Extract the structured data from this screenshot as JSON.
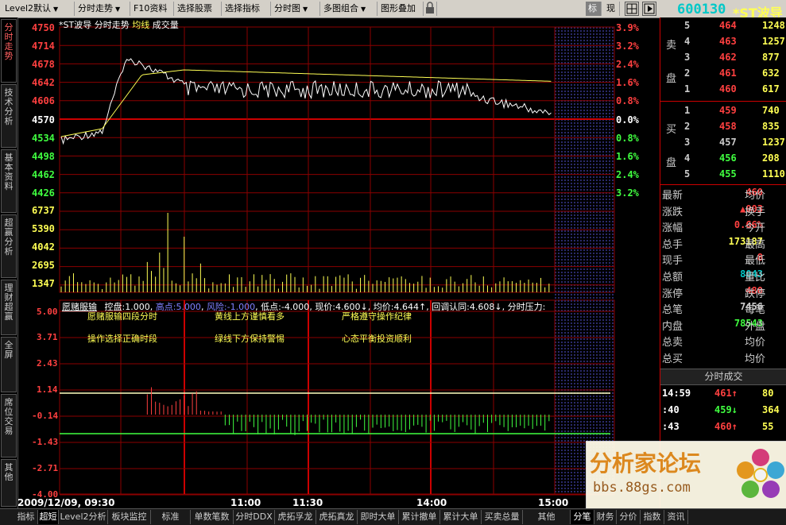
{
  "toolbar": {
    "items": [
      "Level2默认",
      "分时走势",
      "F10资料",
      "选择股票",
      "选择指标",
      "分时图",
      "多图组合",
      "图形叠加"
    ],
    "right_buttons": [
      "标",
      "现"
    ]
  },
  "stock": {
    "code": "600130",
    "name": "*ST波导"
  },
  "left_tabs": [
    {
      "label": "分时走势",
      "active": true
    },
    {
      "label": "技术分析"
    },
    {
      "label": "基本资料"
    },
    {
      "label": "超赢分析"
    },
    {
      "label": "理财超赢"
    },
    {
      "label": "全屏"
    },
    {
      "label": "席位交易"
    },
    {
      "label": "其他"
    }
  ],
  "main": {
    "header": {
      "name": "*ST波导",
      "items": [
        "分时走势",
        "均线",
        "成交量"
      ]
    },
    "price_axis": [
      "4750",
      "4714",
      "4678",
      "4642",
      "4606",
      "4570",
      "4534",
      "4498",
      "4462",
      "4426"
    ],
    "pct_axis": [
      "3.9%",
      "3.2%",
      "2.4%",
      "1.6%",
      "0.8%",
      "0.0%",
      "0.8%",
      "1.6%",
      "2.4%",
      "3.2%"
    ],
    "volume_axis": [
      "6737",
      "5390",
      "4042",
      "2695",
      "1347"
    ],
    "indicator": {
      "name": "愿赌服输",
      "params": [
        {
          "label": "控盘:",
          "value": "1.000"
        },
        {
          "label": "高点:",
          "value": "5.000"
        },
        {
          "label": "风险:",
          "value": "-1.000"
        },
        {
          "label": "低点:",
          "value": "-4.000"
        },
        {
          "label": "现价:",
          "value": "4.600↓"
        },
        {
          "label": "均价:",
          "value": "4.644↑"
        },
        {
          "label": "回调认同:",
          "value": "4.608↓"
        },
        {
          "label": "分时压力:",
          "value": ""
        }
      ],
      "axis": [
        "5.00",
        "3.71",
        "2.43",
        "1.14",
        "-0.14",
        "-1.43",
        "-2.71",
        "-4.00"
      ],
      "annotations": [
        [
          "愿赌服输四段分时",
          "黄线上方谨慎看多",
          "严格遵守操作纪律"
        ],
        [
          "操作选择正确时段",
          "绿线下方保持警惕",
          "心态平衡投资顺利"
        ]
      ]
    },
    "time_axis": {
      "date": "2009/12/09, 09:30",
      "ticks": [
        "11:00",
        "11:30",
        "14:00",
        "15:00"
      ]
    }
  },
  "right_panel": {
    "sell_label": [
      "卖",
      "盘"
    ],
    "buy_label": [
      "买",
      "盘"
    ],
    "sells": [
      {
        "level": "5",
        "price": "464",
        "vol": "1248"
      },
      {
        "level": "4",
        "price": "463",
        "vol": "1257"
      },
      {
        "level": "3",
        "price": "462",
        "vol": "877"
      },
      {
        "level": "2",
        "price": "461",
        "vol": "632"
      },
      {
        "level": "1",
        "price": "460",
        "vol": "617"
      }
    ],
    "buys": [
      {
        "level": "1",
        "price": "459",
        "vol": "740"
      },
      {
        "level": "2",
        "price": "458",
        "vol": "835"
      },
      {
        "level": "3",
        "price": "457",
        "vol": "1237"
      },
      {
        "level": "4",
        "price": "456",
        "vol": "208"
      },
      {
        "level": "5",
        "price": "455",
        "vol": "1110"
      }
    ],
    "stats": [
      {
        "l": "最新",
        "v": "460",
        "c": "#ff4040",
        "r": "均价"
      },
      {
        "l": "涨跌",
        "v": "▲003",
        "c": "#ff4040",
        "r": "换手"
      },
      {
        "l": "涨幅",
        "v": "0.66%",
        "c": "#ff4040",
        "r": "今开"
      },
      {
        "l": "总手",
        "v": "173187",
        "c": "#ffff54",
        "r": "最高"
      },
      {
        "l": "现手",
        "v": "8",
        "c": "#ff4040",
        "r": "最低"
      },
      {
        "l": "总额",
        "v": "8043",
        "c": "#00c8c8",
        "r": "量比"
      },
      {
        "l": "涨停",
        "v": "480",
        "c": "#ff4040",
        "r": "跌停"
      },
      {
        "l": "总笔",
        "v": "7456",
        "c": "#ccc",
        "r": "每笔"
      },
      {
        "l": "内盘",
        "v": "78543",
        "c": "#40ff40",
        "r": "外盘"
      },
      {
        "l": "总卖",
        "v": "",
        "c": "#ccc",
        "r": "均价"
      },
      {
        "l": "总买",
        "v": "",
        "c": "#ccc",
        "r": "均价"
      }
    ],
    "trades_header": "分时成交",
    "trades": [
      {
        "t": "14:59",
        "p": "461↑",
        "pc": "#ff4040",
        "v": "80"
      },
      {
        "t": ":40",
        "p": "459↓",
        "pc": "#40ff40",
        "v": "364"
      },
      {
        "t": ":43",
        "p": "460↑",
        "pc": "#ff4040",
        "v": "55"
      }
    ]
  },
  "bottom_tabs": [
    "指标",
    "超短",
    "Level2分析",
    "板块监控",
    "标准",
    "单数笔数",
    "分时DDX",
    "虎拓孚龙",
    "虎拓真龙",
    "即时大单",
    "累计撤单",
    "累计大单",
    "买卖总量",
    "其他",
    "分笔",
    "财务",
    "分价",
    "指数",
    "资讯"
  ],
  "watermark": {
    "title": "分析家论坛",
    "url": "bbs.88gs.com"
  },
  "colors": {
    "price_line": "#ffffff",
    "avg_line": "#ffff54",
    "grid": "#8b0000",
    "up": "#ff4040",
    "down": "#40ff40"
  }
}
